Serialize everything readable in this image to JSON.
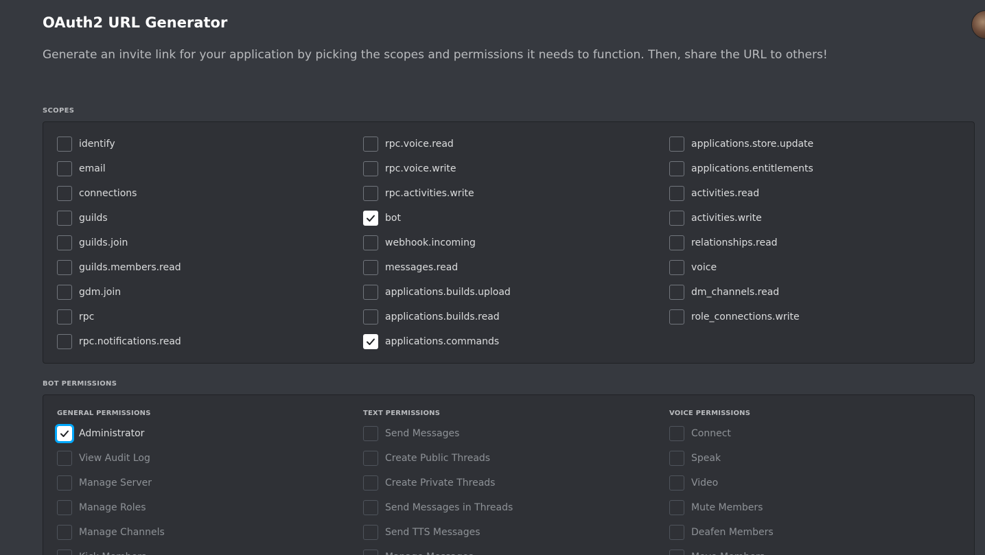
{
  "header": {
    "title": "OAuth2 URL Generator",
    "description": "Generate an invite link for your application by picking the scopes and permissions it needs to function. Then, share the URL to others!"
  },
  "scopes": {
    "label": "SCOPES",
    "columns": [
      [
        {
          "label": "identify",
          "checked": false
        },
        {
          "label": "email",
          "checked": false
        },
        {
          "label": "connections",
          "checked": false
        },
        {
          "label": "guilds",
          "checked": false
        },
        {
          "label": "guilds.join",
          "checked": false
        },
        {
          "label": "guilds.members.read",
          "checked": false
        },
        {
          "label": "gdm.join",
          "checked": false
        },
        {
          "label": "rpc",
          "checked": false
        },
        {
          "label": "rpc.notifications.read",
          "checked": false
        }
      ],
      [
        {
          "label": "rpc.voice.read",
          "checked": false
        },
        {
          "label": "rpc.voice.write",
          "checked": false
        },
        {
          "label": "rpc.activities.write",
          "checked": false
        },
        {
          "label": "bot",
          "checked": true
        },
        {
          "label": "webhook.incoming",
          "checked": false
        },
        {
          "label": "messages.read",
          "checked": false
        },
        {
          "label": "applications.builds.upload",
          "checked": false
        },
        {
          "label": "applications.builds.read",
          "checked": false
        },
        {
          "label": "applications.commands",
          "checked": true
        }
      ],
      [
        {
          "label": "applications.store.update",
          "checked": false
        },
        {
          "label": "applications.entitlements",
          "checked": false
        },
        {
          "label": "activities.read",
          "checked": false
        },
        {
          "label": "activities.write",
          "checked": false
        },
        {
          "label": "relationships.read",
          "checked": false
        },
        {
          "label": "voice",
          "checked": false
        },
        {
          "label": "dm_channels.read",
          "checked": false
        },
        {
          "label": "role_connections.write",
          "checked": false
        }
      ]
    ]
  },
  "bot_permissions": {
    "label": "BOT PERMISSIONS",
    "groups": [
      {
        "heading": "GENERAL PERMISSIONS",
        "items": [
          {
            "label": "Administrator",
            "checked": true,
            "disabled": false,
            "focused": true
          },
          {
            "label": "View Audit Log",
            "checked": false,
            "disabled": true
          },
          {
            "label": "Manage Server",
            "checked": false,
            "disabled": true
          },
          {
            "label": "Manage Roles",
            "checked": false,
            "disabled": true
          },
          {
            "label": "Manage Channels",
            "checked": false,
            "disabled": true
          },
          {
            "label": "Kick Members",
            "checked": false,
            "disabled": true
          }
        ]
      },
      {
        "heading": "TEXT PERMISSIONS",
        "items": [
          {
            "label": "Send Messages",
            "checked": false,
            "disabled": true
          },
          {
            "label": "Create Public Threads",
            "checked": false,
            "disabled": true
          },
          {
            "label": "Create Private Threads",
            "checked": false,
            "disabled": true
          },
          {
            "label": "Send Messages in Threads",
            "checked": false,
            "disabled": true
          },
          {
            "label": "Send TTS Messages",
            "checked": false,
            "disabled": true
          },
          {
            "label": "Manage Messages",
            "checked": false,
            "disabled": true
          }
        ]
      },
      {
        "heading": "VOICE PERMISSIONS",
        "items": [
          {
            "label": "Connect",
            "checked": false,
            "disabled": true
          },
          {
            "label": "Speak",
            "checked": false,
            "disabled": true
          },
          {
            "label": "Video",
            "checked": false,
            "disabled": true
          },
          {
            "label": "Mute Members",
            "checked": false,
            "disabled": true
          },
          {
            "label": "Deafen Members",
            "checked": false,
            "disabled": true
          },
          {
            "label": "Move Members",
            "checked": false,
            "disabled": true
          }
        ]
      }
    ]
  },
  "colors": {
    "background": "#36393f",
    "panel": "#2f3136",
    "focus_outline": "#00a8fc"
  },
  "icons": {
    "checkmark": "checkmark-icon",
    "avatar": "avatar-icon"
  }
}
